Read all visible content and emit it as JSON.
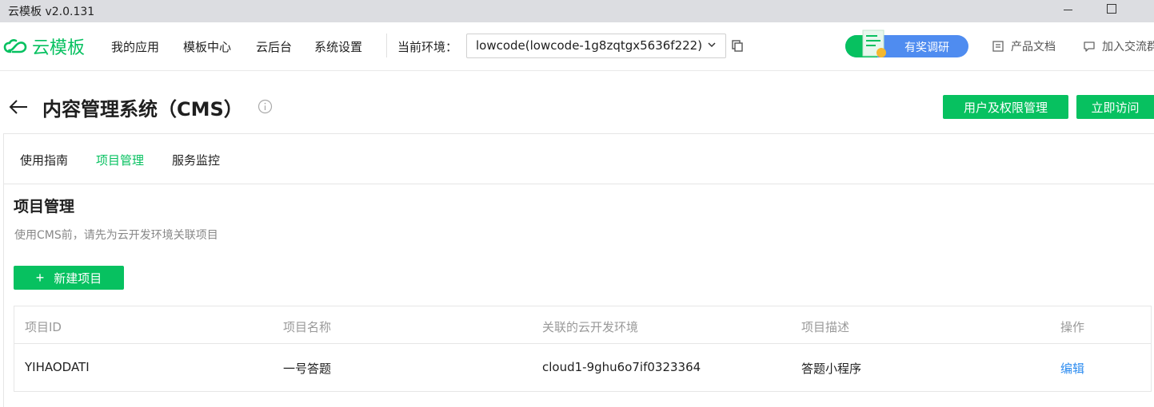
{
  "window": {
    "title": "云模板 v2.0.131"
  },
  "nav": {
    "logo_text": "云模板",
    "items": [
      "我的应用",
      "模板中心",
      "云后台",
      "系统设置"
    ],
    "env_label": "当前环境：",
    "env_value": "lowcode(lowcode-1g8zqtgx5636f222)",
    "survey_label": "有奖调研",
    "doc_link": "产品文档",
    "join_link": "加入交流群"
  },
  "page": {
    "title": "内容管理系统（CMS）",
    "perm_button": "用户及权限管理",
    "visit_button": "立即访问"
  },
  "tabs": [
    {
      "label": "使用指南",
      "active": false
    },
    {
      "label": "项目管理",
      "active": true
    },
    {
      "label": "服务监控",
      "active": false
    }
  ],
  "section": {
    "title": "项目管理",
    "desc": "使用CMS前，请先为云开发环境关联项目",
    "new_button": "新建项目"
  },
  "table": {
    "headers": [
      "项目ID",
      "项目名称",
      "关联的云开发环境",
      "项目描述",
      "操作"
    ],
    "rows": [
      [
        "YIHAODATI",
        "一号答题",
        "cloud1-9ghu6o7if0323364",
        "答题小程序",
        "编辑"
      ]
    ]
  },
  "colors": {
    "accent": "#07c160",
    "link": "#2d8cf0",
    "survey": "#4f8cf0"
  }
}
